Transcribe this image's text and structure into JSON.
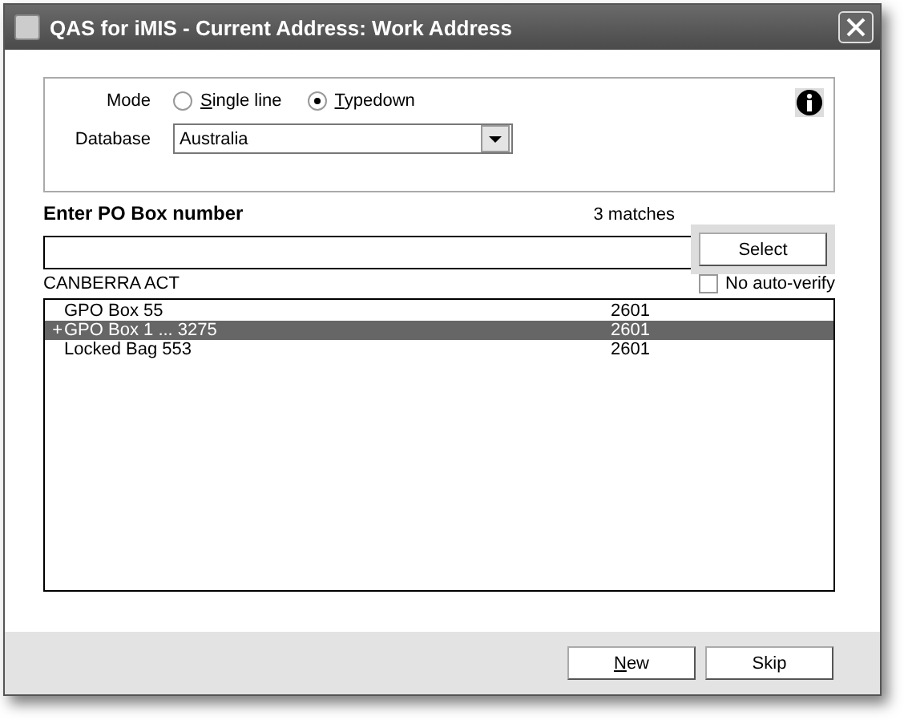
{
  "window": {
    "title": "QAS for iMIS - Current Address: Work Address"
  },
  "mode": {
    "label": "Mode",
    "options": [
      {
        "label": "Single line",
        "underline_first": true,
        "selected": false
      },
      {
        "label": "Typedown",
        "underline_first": true,
        "selected": true
      }
    ]
  },
  "database": {
    "label": "Database",
    "value": "Australia"
  },
  "prompt": "Enter PO Box number",
  "matches": "3 matches",
  "select_button": "Select",
  "locality": "CANBERRA  ACT",
  "no_auto_verify": {
    "label": "No auto-verify",
    "checked": false
  },
  "results": [
    {
      "text": "GPO Box 55",
      "postcode": "2601",
      "selected": false
    },
    {
      "prefix": "+",
      "text": "GPO Box 1 ... 3275",
      "postcode": "2601",
      "selected": true
    },
    {
      "text": "Locked Bag 553",
      "postcode": "2601",
      "selected": false
    }
  ],
  "buttons": [
    {
      "label": "New",
      "underline_first": true
    },
    {
      "label": "Skip",
      "underline_first": false
    }
  ]
}
